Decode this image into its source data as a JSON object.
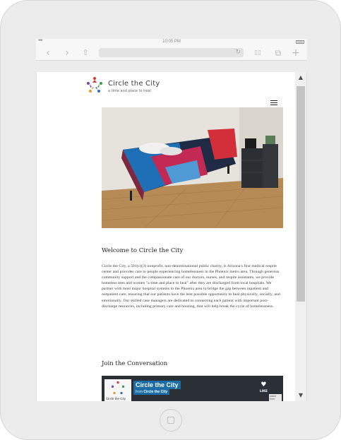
{
  "device": {
    "clock": "10:05 PM",
    "signal": "•••••",
    "wifi_icon": "wifi-icon",
    "battery_icon": "battery-icon"
  },
  "browser": {
    "back_icon": "‹",
    "forward_icon": "›",
    "share_icon": "⇧",
    "reload_icon": "↻",
    "reader_icon": "▯▯",
    "tabs_icon": "⧉",
    "new_tab_icon": "+"
  },
  "site": {
    "brand_name": "Circle the City",
    "tagline": "a time and place to heal",
    "colors": {
      "logo_red": "#d23a3a",
      "logo_green": "#3a9a55",
      "logo_blue": "#2f6fb8",
      "logo_orange": "#e79a2c",
      "logo_purple": "#7a4aa0"
    }
  },
  "content": {
    "welcome_heading": "Welcome to Circle the City",
    "intro_text": "Circle the City, a 501(c)(3) nonprofit, non-denominational public charity, is Arizona's first medical respite center and provides care to people experiencing homelessness in the Phoenix metro area. Through generous community support and the compassionate care of our doctors, nurses, and respite assistants, we provide homeless men and women \"a time and place to heal\" after they are discharged from local hospitals. We partner with most major hospital systems in the Phoenix area to bridge the gap between inpatient and outpatient care, ensuring that our patients have the best possible opportunity to heal physically, socially, and emotionally. Our skilled case managers are dedicated to connecting each patient with important post-discharge resources, including primary care and housing, that will help break the cycle of homelessness.",
    "join_heading": "Join the Conversation"
  },
  "video": {
    "title": "Circle the City",
    "from_prefix": "from",
    "from_name": "Circle the City",
    "channel_label": "Circle the City",
    "like_label": "LIKE",
    "vimeo_label": "watch from"
  },
  "scrollbar": {
    "up_icon": "▲",
    "down_icon": "▼"
  }
}
